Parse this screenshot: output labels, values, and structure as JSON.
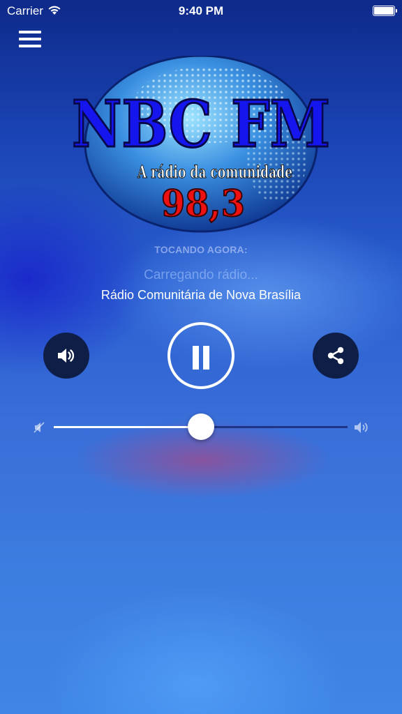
{
  "status_bar": {
    "carrier": "Carrier",
    "time": "9:40 PM"
  },
  "logo": {
    "name": "NBC FM",
    "tagline": "A rádio da comunidade",
    "frequency": "98,3"
  },
  "player": {
    "now_playing_label": "TOCANDO AGORA:",
    "loading_text": "Carregando rádio...",
    "station_name": "Rádio Comunitária de Nova Brasília",
    "state": "playing",
    "volume": 0.5
  },
  "icons": {
    "menu": "hamburger-menu-icon",
    "volume": "speaker-icon",
    "play_pause": "pause-icon",
    "share": "share-icon",
    "volume_min": "volume-mute-icon",
    "volume_max": "volume-max-icon"
  },
  "colors": {
    "button_bg": "#0f1e46",
    "track_empty": "#1f3486",
    "logo_text": "#1515ee",
    "frequency": "#ee1111"
  }
}
